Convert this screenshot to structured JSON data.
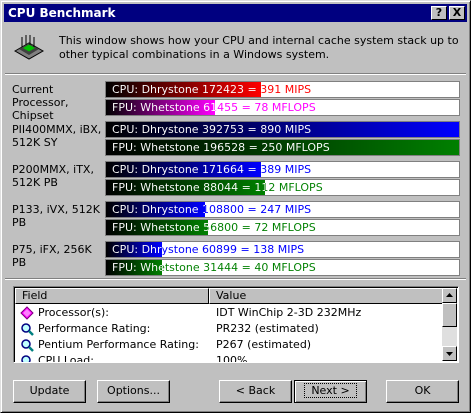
{
  "window": {
    "title": "CPU Benchmark",
    "help_button": "?",
    "close_button": "X"
  },
  "intro": {
    "text": "This window shows how your CPU and internal cache system stack up to other typical combinations in a Windows system.",
    "icon": "cpu-chip-icon"
  },
  "benchmarks": [
    {
      "label": "Current Processor, Chipset",
      "cpu": {
        "text": "CPU: Dhrystone 172423 = 391 MIPS",
        "fraction": 0.44,
        "fill_color": "#ff0000",
        "text_color": "#ffffff"
      },
      "fpu": {
        "text": "FPU: Whetstone 61455 = 78 MFLOPS",
        "fraction": 0.31,
        "fill_color": "#ff00ff",
        "text_color": "#ffffff"
      }
    },
    {
      "label": "PII400MMX, iBX, 512K SY",
      "cpu": {
        "text": "CPU: Dhrystone 392753 = 890 MIPS",
        "fraction": 1.0,
        "fill_color": "#0000ff",
        "text_color": "#ffffff"
      },
      "fpu": {
        "text": "FPU: Whetstone 196528 = 250 MFLOPS",
        "fraction": 1.0,
        "fill_color": "#008000",
        "text_color": "#ffffff"
      }
    },
    {
      "label": "P200MMX, iTX, 512K PB",
      "cpu": {
        "text": "CPU: Dhrystone 171664 = 389 MIPS",
        "fraction": 0.44,
        "fill_color": "#0000ff",
        "text_color": "#ffffff"
      },
      "fpu": {
        "text": "FPU: Whetstone 88044 = 112 MFLOPS",
        "fraction": 0.45,
        "fill_color": "#008000",
        "text_color": "#ffffff"
      }
    },
    {
      "label": "P133, iVX, 512K PB",
      "cpu": {
        "text": "CPU: Dhrystone 108800 = 247 MIPS",
        "fraction": 0.28,
        "fill_color": "#0000ff",
        "text_color": "#ffffff"
      },
      "fpu": {
        "text": "FPU: Whetstone 56800 = 72 MFLOPS",
        "fraction": 0.29,
        "fill_color": "#008000",
        "text_color": "#ffffff"
      }
    },
    {
      "label": "P75, iFX, 256K PB",
      "cpu": {
        "text": "CPU: Dhrystone 60899 = 138 MIPS",
        "fraction": 0.16,
        "fill_color": "#0000ff",
        "text_color": "#ffffff"
      },
      "fpu": {
        "text": "FPU: Whetstone 31444 = 40 MFLOPS",
        "fraction": 0.16,
        "fill_color": "#008000",
        "text_color": "#ffffff"
      }
    }
  ],
  "details": {
    "columns": [
      "Field",
      "Value"
    ],
    "rows": [
      {
        "icon": "processor-diamond-icon",
        "field": "Processor(s):",
        "value": "IDT WinChip 2-3D 232MHz"
      },
      {
        "icon": "magnifier-icon",
        "field": "Performance Rating:",
        "value": "PR232  (estimated)"
      },
      {
        "icon": "magnifier-icon",
        "field": "Pentium Performance Rating:",
        "value": "P267  (estimated)"
      },
      {
        "icon": "magnifier-icon",
        "field": "CPU Load:",
        "value": "100%"
      }
    ]
  },
  "buttons": {
    "update": "Update",
    "options": "Options...",
    "back": "< Back",
    "next": "Next >",
    "ok": "OK"
  }
}
